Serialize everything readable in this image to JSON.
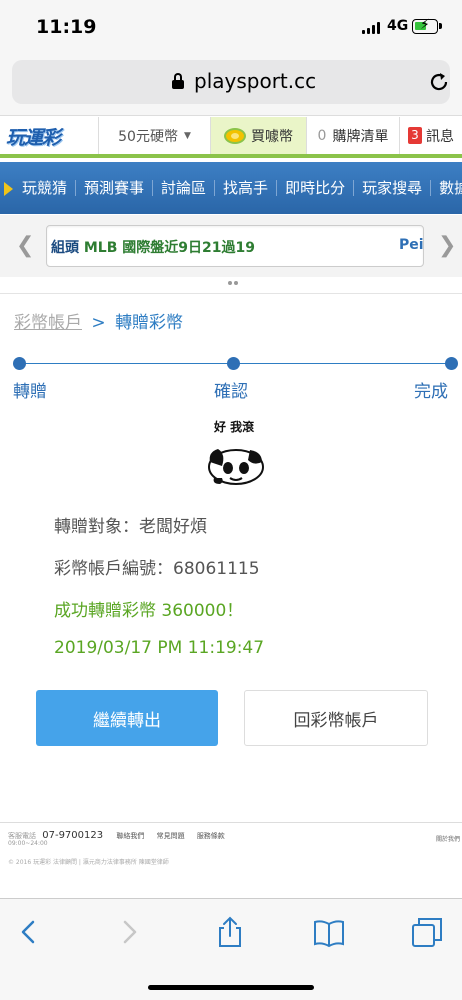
{
  "status_bar": {
    "time": "11:19",
    "network": "4G"
  },
  "browser": {
    "url": "playsport.cc"
  },
  "site_header": {
    "logo": "玩運彩",
    "coin_dropdown": "50元硬幣",
    "buy_coin": "買噱幣",
    "cart_count": "0",
    "cart_label": "購牌清單",
    "msg_count": "3",
    "msg_label": "訊息"
  },
  "nav": {
    "items": [
      "玩競猜",
      "預測賽事",
      "討論區",
      "找高手",
      "即時比分",
      "玩家搜尋",
      "數據"
    ]
  },
  "ticker": {
    "lead": "組頭",
    "text": " MLB 國際盤近9日21過19",
    "tail": "Pei"
  },
  "breadcrumb": {
    "parent": "彩幣帳戶",
    "separator": ">",
    "current": "轉贈彩幣"
  },
  "steps": [
    "轉贈",
    "確認",
    "完成"
  ],
  "meme": {
    "caption": "好 我滾"
  },
  "result": {
    "recipient_line": "轉贈對象：老闆好煩",
    "account_line": "彩幣帳戶編號：68061115",
    "success_line": "成功轉贈彩幣 360000！",
    "timestamp": "2019/03/17 PM 11:19:47"
  },
  "buttons": {
    "continue": "繼續轉出",
    "back": "回彩幣帳戶"
  },
  "footer": {
    "service_label": "客服電話",
    "service_hours": "09:00~24:00",
    "phone": "07-9700123",
    "links": [
      "聯絡我們",
      "常見問題",
      "服務條款"
    ],
    "mobile": "關於我們",
    "copyright": "© 2016 玩運彩  法律顧問 | 瀛元商力法律事務所 陳國堂律師"
  },
  "colors": {
    "accent": "#2e6fb5",
    "success": "#5aa623",
    "button": "#45a3ea"
  }
}
